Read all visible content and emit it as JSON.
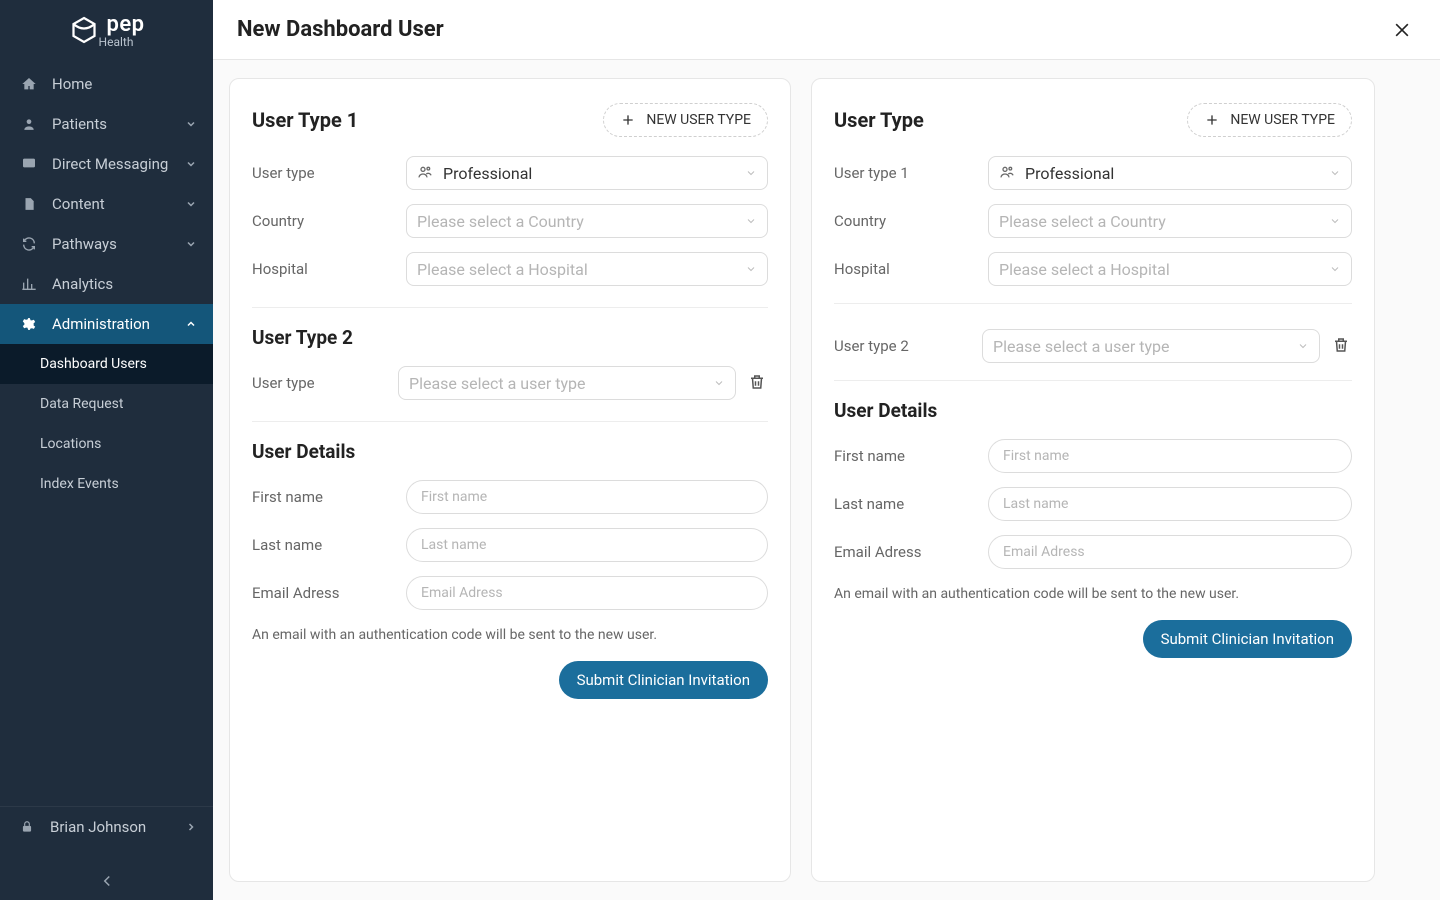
{
  "brand": {
    "name": "pep",
    "sub": "Health"
  },
  "sidebar": {
    "items": [
      {
        "label": "Home",
        "icon": "home",
        "expandable": false
      },
      {
        "label": "Patients",
        "icon": "user",
        "expandable": true
      },
      {
        "label": "Direct Messaging",
        "icon": "chat",
        "expandable": true
      },
      {
        "label": "Content",
        "icon": "doc",
        "expandable": true
      },
      {
        "label": "Pathways",
        "icon": "refresh",
        "expandable": true
      },
      {
        "label": "Analytics",
        "icon": "chart",
        "expandable": false
      },
      {
        "label": "Administration",
        "icon": "gear",
        "expandable": true,
        "active": true
      }
    ],
    "admin_sub": [
      {
        "label": "Dashboard Users",
        "selected": true
      },
      {
        "label": "Data Request"
      },
      {
        "label": "Locations"
      },
      {
        "label": "Index Events"
      }
    ]
  },
  "user": {
    "name": "Brian Johnson"
  },
  "page": {
    "title": "New Dashboard User"
  },
  "left": {
    "section1": {
      "title": "User Type 1",
      "add_btn": "NEW USER TYPE"
    },
    "fields": {
      "type_label": "User type",
      "type_value": "Professional",
      "country_label": "Country",
      "country_ph": "Please select a Country",
      "hospital_label": "Hospital",
      "hospital_ph": "Please select a Hospital"
    },
    "section2": {
      "title": "User Type 2",
      "type_label": "User type",
      "type_ph": "Please select a user type"
    },
    "details": {
      "title": "User Details",
      "first_label": "First name",
      "first_ph": "First name",
      "last_label": "Last name",
      "last_ph": "Last name",
      "email_label": "Email Adress",
      "email_ph": "Email Adress"
    },
    "hint": "An email with an authentication code will be sent to the new user.",
    "submit": "Submit Clinician Invitation"
  },
  "right": {
    "section1": {
      "title": "User Type",
      "add_btn": "NEW USER TYPE"
    },
    "fields": {
      "type1_label": "User type 1",
      "type1_value": "Professional",
      "country_label": "Country",
      "country_ph": "Please select a Country",
      "hospital_label": "Hospital",
      "hospital_ph": "Please select a Hospital",
      "type2_label": "User type 2",
      "type2_ph": "Please select a user type"
    },
    "details": {
      "title": "User Details",
      "first_label": "First name",
      "first_ph": "First name",
      "last_label": "Last name",
      "last_ph": "Last name",
      "email_label": "Email Adress",
      "email_ph": "Email Adress"
    },
    "hint": "An email with an authentication code will be sent to the new user.",
    "submit": "Submit Clinician Invitation"
  }
}
